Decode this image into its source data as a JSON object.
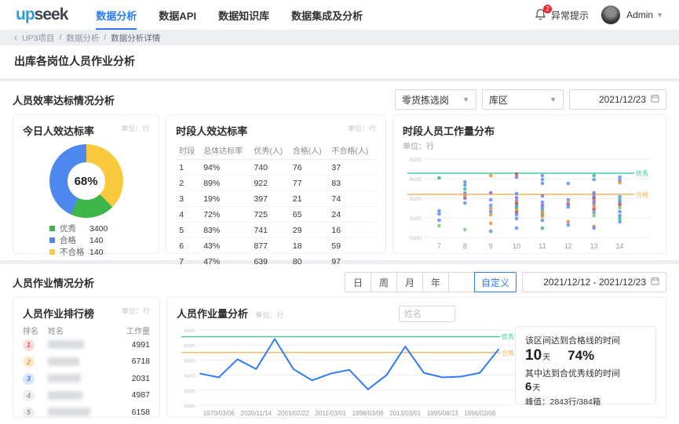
{
  "header": {
    "logo": {
      "part1": "up",
      "part2": "seek"
    },
    "nav_items": [
      {
        "label": "数据分析",
        "active": true
      },
      {
        "label": "数据API",
        "active": false
      },
      {
        "label": "数据知识库",
        "active": false
      },
      {
        "label": "数据集成及分析",
        "active": false
      }
    ],
    "alert": {
      "badge": "2",
      "label": "异常提示"
    },
    "user": {
      "name": "Admin"
    }
  },
  "breadcrumb": {
    "back_arrow": "‹",
    "items": [
      "UP3项目",
      "数据分析",
      "数据分析详情"
    ],
    "separator": "/"
  },
  "page_title": "出库各岗位人员作业分析",
  "efficiency_section": {
    "title": "人员效率达标情况分析",
    "filters": {
      "post_select": "零货拣选岗",
      "area_select": "库区",
      "date": "2021/12/23"
    },
    "donut_card": {
      "title": "今日人效达标率",
      "unit": "单位：行",
      "center_value": "68%"
    },
    "period_table_card": {
      "title": "时段人效达标率",
      "unit": "单位：行",
      "headers": [
        "时段",
        "总体达标率",
        "优秀(人)",
        "合格(人)",
        "不合格(人)"
      ],
      "rows": [
        [
          "1",
          "94%",
          "740",
          "76",
          "37"
        ],
        [
          "2",
          "89%",
          "922",
          "77",
          "83"
        ],
        [
          "3",
          "19%",
          "397",
          "21",
          "74"
        ],
        [
          "4",
          "72%",
          "725",
          "65",
          "24"
        ],
        [
          "5",
          "83%",
          "741",
          "29",
          "16"
        ],
        [
          "6",
          "43%",
          "877",
          "18",
          "59"
        ],
        [
          "7",
          "47%",
          "639",
          "80",
          "97"
        ]
      ]
    },
    "scatter_card": {
      "title": "时段人员工作量分布",
      "unit": "单位：行"
    }
  },
  "work_section": {
    "title": "人员作业情况分析",
    "tabs": [
      {
        "label": "日",
        "active": false
      },
      {
        "label": "周",
        "active": false
      },
      {
        "label": "月",
        "active": false
      },
      {
        "label": "年",
        "active": false
      },
      {
        "label": "",
        "active": false
      },
      {
        "label": "自定义",
        "active": true
      }
    ],
    "date_range": "2021/12/12 - 2021/12/23",
    "rank_card": {
      "title": "人员作业排行榜",
      "unit": "单位：行",
      "headers": [
        "排名",
        "姓名",
        "工作量"
      ],
      "rows": [
        {
          "rank": "1",
          "value": "4991"
        },
        {
          "rank": "2",
          "value": "6718"
        },
        {
          "rank": "3",
          "value": "2031"
        },
        {
          "rank": "4",
          "value": "4987"
        },
        {
          "rank": "5",
          "value": "6158"
        }
      ]
    },
    "line_card": {
      "title": "人员作业量分析",
      "unit": "单位：行",
      "name_placeholder": "姓名"
    },
    "summary_card": {
      "qualified_label": "该区间达到合格线的时间",
      "qualified_days": "10",
      "days_unit": "天",
      "qualified_pct": "74%",
      "excellent_label": "其中达到合优秀线的时间",
      "excellent_days": "6",
      "peak_label": "峰值：",
      "peak_value": "2843行/384箱"
    }
  },
  "chart_data": [
    {
      "type": "pie",
      "title": "今日人效达标率",
      "unit": "行",
      "center_label": "68%",
      "legend": [
        {
          "label": "优秀",
          "value": 3400,
          "color": "#3eb54b"
        },
        {
          "label": "合格",
          "value": 140,
          "color": "#4e87ee"
        },
        {
          "label": "不合格",
          "value": 140,
          "color": "#fbc93d"
        }
      ],
      "segments_from_top_clockwise": [
        {
          "label": "不合格",
          "color": "#fbc93d",
          "deg": 135
        },
        {
          "label": "优秀",
          "color": "#3eb54b",
          "deg": 70
        },
        {
          "label": "合格",
          "color": "#4e87ee",
          "deg": 155
        }
      ]
    },
    {
      "type": "scatter",
      "title": "时段人员工作量分布",
      "x_categories": [
        7,
        8,
        9,
        10,
        11,
        12,
        13,
        14
      ],
      "y_axis_labels": [
        "num",
        "num",
        "num",
        "num",
        "num"
      ],
      "ylim": [
        0,
        100
      ],
      "thresholds": [
        {
          "label": "优秀",
          "y": 82,
          "color": "#3ecf9e"
        },
        {
          "label": "合格",
          "y": 55,
          "color": "#f8b55f"
        }
      ],
      "palette": [
        "#5b8ff9",
        "#3bb787",
        "#f0883a",
        "#9a66c9",
        "#b5554d",
        "#7ec975"
      ],
      "points": [
        {
          "x": 7,
          "y": 76,
          "c": 1
        },
        {
          "x": 7,
          "y": 34,
          "c": 0
        },
        {
          "x": 7,
          "y": 30,
          "c": 0
        },
        {
          "x": 7,
          "y": 22,
          "c": 0
        },
        {
          "x": 7,
          "y": 15,
          "c": 5
        },
        {
          "x": 8,
          "y": 71,
          "c": 0
        },
        {
          "x": 8,
          "y": 67,
          "c": 0
        },
        {
          "x": 8,
          "y": 62,
          "c": 1
        },
        {
          "x": 8,
          "y": 57,
          "c": 0
        },
        {
          "x": 8,
          "y": 53,
          "c": 2
        },
        {
          "x": 8,
          "y": 50,
          "c": 3
        },
        {
          "x": 8,
          "y": 44,
          "c": 0
        },
        {
          "x": 8,
          "y": 10,
          "c": 5
        },
        {
          "x": 9,
          "y": 79,
          "c": 2
        },
        {
          "x": 9,
          "y": 57,
          "c": 3
        },
        {
          "x": 9,
          "y": 48,
          "c": 0
        },
        {
          "x": 9,
          "y": 41,
          "c": 0
        },
        {
          "x": 9,
          "y": 37,
          "c": 2
        },
        {
          "x": 9,
          "y": 33,
          "c": 0
        },
        {
          "x": 9,
          "y": 29,
          "c": 2
        },
        {
          "x": 9,
          "y": 18,
          "c": 2
        },
        {
          "x": 9,
          "y": 8,
          "c": 0
        },
        {
          "x": 10,
          "y": 81,
          "c": 4
        },
        {
          "x": 10,
          "y": 77,
          "c": 3
        },
        {
          "x": 10,
          "y": 56,
          "c": 0
        },
        {
          "x": 10,
          "y": 51,
          "c": 3
        },
        {
          "x": 10,
          "y": 47,
          "c": 0
        },
        {
          "x": 10,
          "y": 45,
          "c": 2
        },
        {
          "x": 10,
          "y": 43,
          "c": 4
        },
        {
          "x": 10,
          "y": 40,
          "c": 0
        },
        {
          "x": 10,
          "y": 38,
          "c": 1
        },
        {
          "x": 10,
          "y": 35,
          "c": 2
        },
        {
          "x": 10,
          "y": 32,
          "c": 4
        },
        {
          "x": 10,
          "y": 29,
          "c": 0
        },
        {
          "x": 10,
          "y": 24,
          "c": 0
        },
        {
          "x": 10,
          "y": 12,
          "c": 0
        },
        {
          "x": 11,
          "y": 79,
          "c": 0
        },
        {
          "x": 11,
          "y": 74,
          "c": 0
        },
        {
          "x": 11,
          "y": 69,
          "c": 0
        },
        {
          "x": 11,
          "y": 53,
          "c": 3
        },
        {
          "x": 11,
          "y": 45,
          "c": 0
        },
        {
          "x": 11,
          "y": 41,
          "c": 3
        },
        {
          "x": 11,
          "y": 38,
          "c": 0
        },
        {
          "x": 11,
          "y": 35,
          "c": 1
        },
        {
          "x": 11,
          "y": 32,
          "c": 2
        },
        {
          "x": 11,
          "y": 29,
          "c": 1
        },
        {
          "x": 11,
          "y": 27,
          "c": 2
        },
        {
          "x": 11,
          "y": 22,
          "c": 0
        },
        {
          "x": 11,
          "y": 12,
          "c": 1
        },
        {
          "x": 12,
          "y": 69,
          "c": 0
        },
        {
          "x": 12,
          "y": 48,
          "c": 0
        },
        {
          "x": 12,
          "y": 44,
          "c": 2
        },
        {
          "x": 12,
          "y": 42,
          "c": 3
        },
        {
          "x": 12,
          "y": 39,
          "c": 0
        },
        {
          "x": 12,
          "y": 20,
          "c": 2
        },
        {
          "x": 12,
          "y": 16,
          "c": 0
        },
        {
          "x": 13,
          "y": 79,
          "c": 1
        },
        {
          "x": 13,
          "y": 74,
          "c": 0
        },
        {
          "x": 13,
          "y": 57,
          "c": 3
        },
        {
          "x": 13,
          "y": 53,
          "c": 0
        },
        {
          "x": 13,
          "y": 50,
          "c": 4
        },
        {
          "x": 13,
          "y": 46,
          "c": 3
        },
        {
          "x": 13,
          "y": 43,
          "c": 0
        },
        {
          "x": 13,
          "y": 40,
          "c": 2
        },
        {
          "x": 13,
          "y": 36,
          "c": 4
        },
        {
          "x": 13,
          "y": 32,
          "c": 0
        },
        {
          "x": 13,
          "y": 28,
          "c": 5
        },
        {
          "x": 13,
          "y": 14,
          "c": 2
        },
        {
          "x": 13,
          "y": 12,
          "c": 0
        },
        {
          "x": 14,
          "y": 77,
          "c": 0
        },
        {
          "x": 14,
          "y": 73,
          "c": 0
        },
        {
          "x": 14,
          "y": 70,
          "c": 2
        },
        {
          "x": 14,
          "y": 52,
          "c": 0
        },
        {
          "x": 14,
          "y": 48,
          "c": 1
        },
        {
          "x": 14,
          "y": 45,
          "c": 0
        },
        {
          "x": 14,
          "y": 42,
          "c": 4
        },
        {
          "x": 14,
          "y": 38,
          "c": 5
        },
        {
          "x": 14,
          "y": 33,
          "c": 0
        },
        {
          "x": 14,
          "y": 28,
          "c": 0
        },
        {
          "x": 14,
          "y": 24,
          "c": 1
        },
        {
          "x": 14,
          "y": 20,
          "c": 0
        }
      ]
    },
    {
      "type": "line",
      "title": "人员作业量分析",
      "x_labels": [
        "1970/03/06",
        "2020/11/14",
        "2001/02/22",
        "2011/03/01",
        "1998/03/06",
        "2013/03/01",
        "1995/08/13",
        "1996/02/08"
      ],
      "y_axis_labels": [
        "num",
        "num",
        "num",
        "num",
        "num",
        "num"
      ],
      "ylim": [
        0,
        100
      ],
      "thresholds": [
        {
          "label": "优秀",
          "y": 91,
          "color": "#3ecf9e"
        },
        {
          "label": "合格",
          "y": 70,
          "color": "#f8b55f"
        }
      ],
      "color": "#2f7cf6",
      "values": [
        42,
        37,
        61,
        48,
        88,
        48,
        33,
        42,
        47,
        21,
        40,
        78,
        43,
        37,
        38,
        43,
        74
      ]
    }
  ]
}
